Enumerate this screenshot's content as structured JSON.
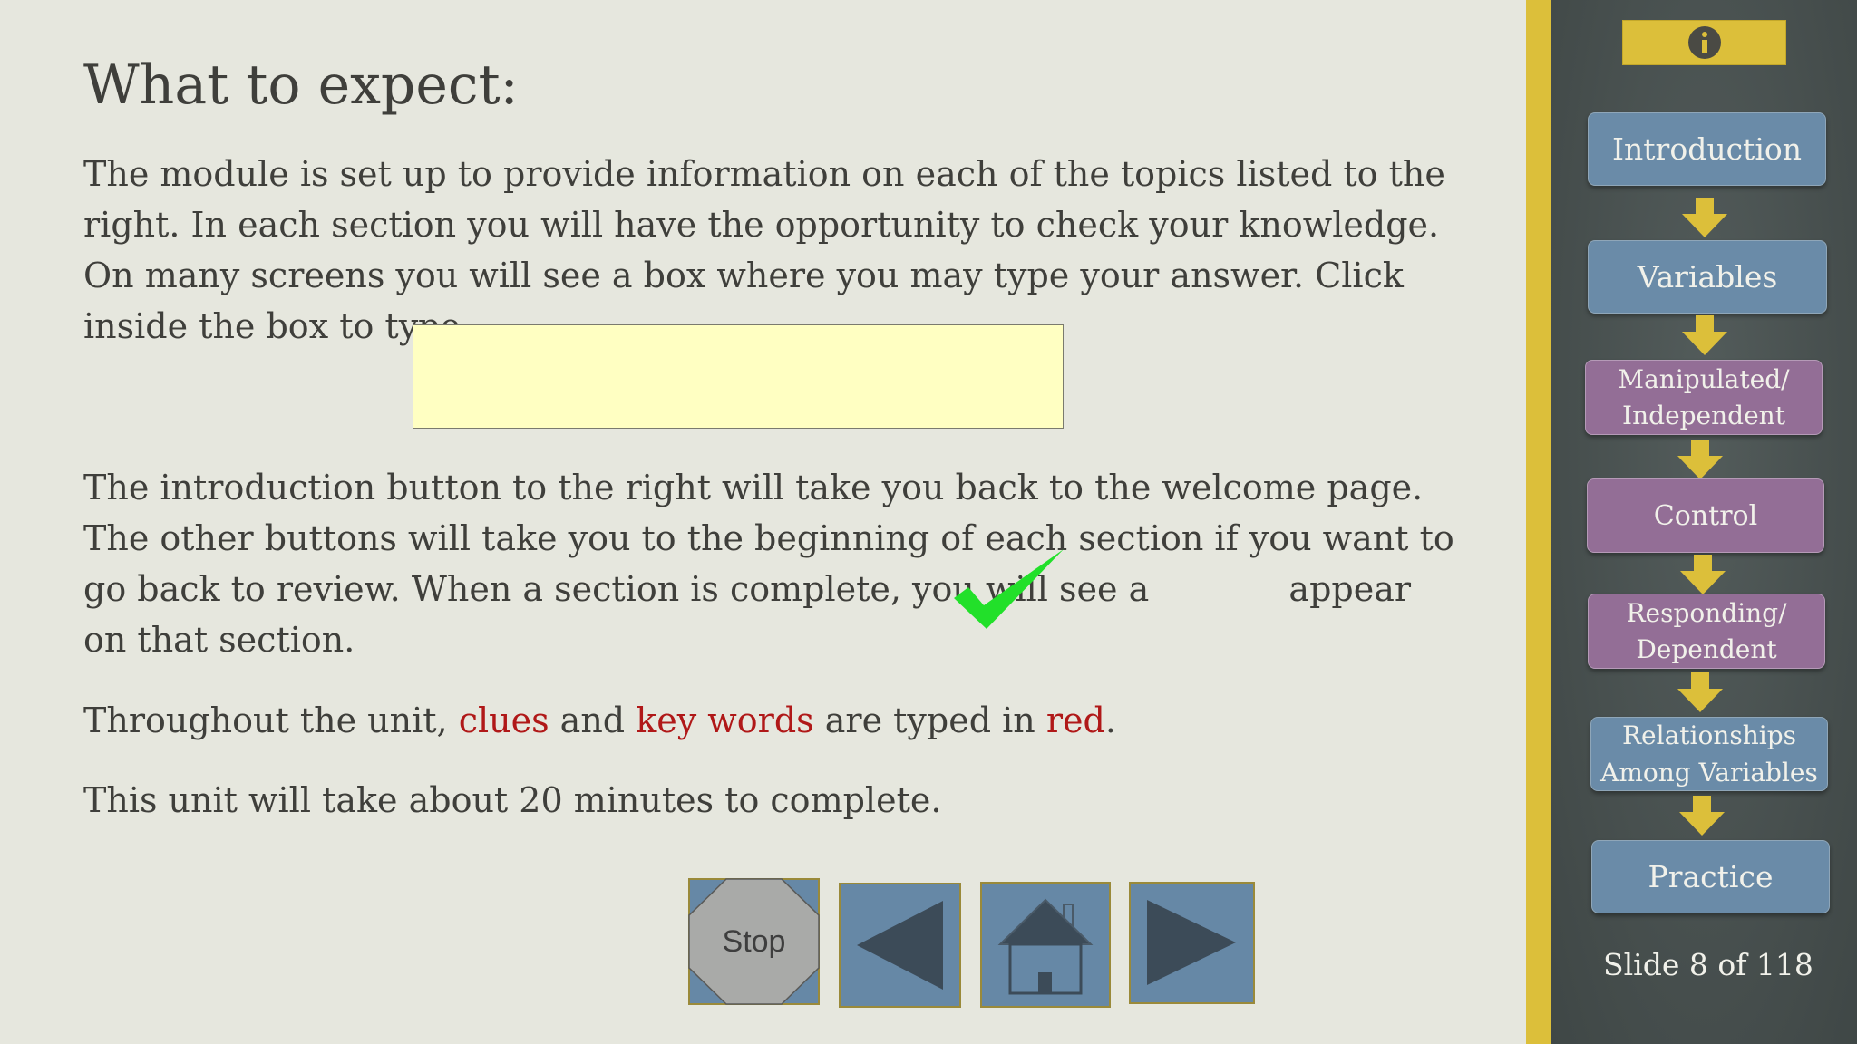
{
  "content": {
    "title": "What to expect:",
    "p1": "The module is set up to provide information on each of the topics listed to the right.  In each section you will have the opportunity to check your knowledge.  On many screens you will see a box where you may type your answer.  Click inside the box to type.",
    "p2_before": "The introduction button to the right will take you back to the welcome page.  The other buttons will take you to the beginning of each section if you want to go back to review. When a section is complete, you will see a ",
    "p2_after": " appear on that section.",
    "p3_pre": "Throughout the unit, ",
    "p3_red1": "clues",
    "p3_mid": " and ",
    "p3_red2": "key words",
    "p3_mid2": " are typed in ",
    "p3_red3": "red",
    "p3_end": ".",
    "p4": "This unit will take about 20 minutes to complete.",
    "answer_value": ""
  },
  "nav": {
    "stop_label": "Stop",
    "back_icon": "triangle-left-icon",
    "home_icon": "house-icon",
    "next_icon": "triangle-right-icon"
  },
  "sidebar": {
    "info_icon": "info-icon",
    "sections": [
      {
        "label": "Introduction",
        "color": "#6a8ba8"
      },
      {
        "label": "Variables",
        "color": "#6a8ba8"
      },
      {
        "label": "Manipulated/ Independent",
        "color": "#936e96"
      },
      {
        "label": "Control",
        "color": "#936e96"
      },
      {
        "label": "Responding/ Dependent",
        "color": "#936e96"
      },
      {
        "label": "Relationships Among Variables",
        "color": "#6a8ba8"
      },
      {
        "label": "Practice",
        "color": "#6a8ba8"
      }
    ],
    "slide_counter": "Slide 8 of 118"
  },
  "colors": {
    "background": "#e6e7de",
    "accent_yellow": "#dcbf3a",
    "key_red": "#b01818",
    "nav_blue": "#6688a6",
    "check_green": "#22e02a"
  }
}
